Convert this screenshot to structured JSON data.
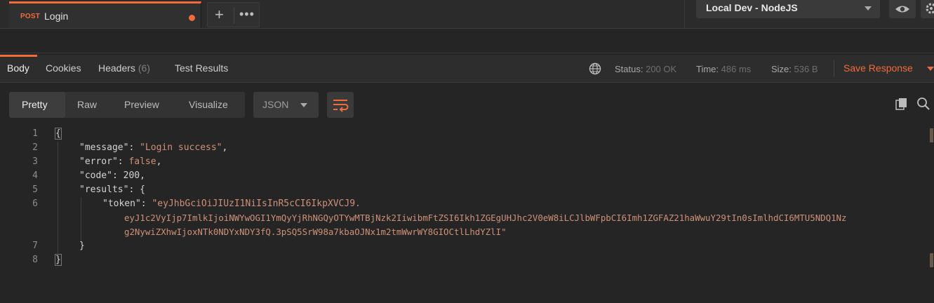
{
  "tab": {
    "method": "POST",
    "name": "Login"
  },
  "environment": {
    "selected": "Local Dev - NodeJS"
  },
  "response_tabs": {
    "body": "Body",
    "cookies": "Cookies",
    "headers": "Headers",
    "headers_count": "(6)",
    "test_results": "Test Results"
  },
  "status": {
    "status_label": "Status:",
    "status_value": "200 OK",
    "time_label": "Time:",
    "time_value": "486 ms",
    "size_label": "Size:",
    "size_value": "536 B",
    "save_response": "Save Response"
  },
  "view_modes": {
    "pretty": "Pretty",
    "raw": "Raw",
    "preview": "Preview",
    "visualize": "Visualize",
    "format": "JSON"
  },
  "code": {
    "line_numbers": [
      "1",
      "2",
      "3",
      "4",
      "5",
      "6",
      "7",
      "8"
    ],
    "open_brace": "{",
    "message_key": "\"message\"",
    "message_value": "\"Login success\"",
    "error_key": "\"error\"",
    "error_value": "false",
    "code_key": "\"code\"",
    "code_value": "200",
    "results_key": "\"results\"",
    "token_key": "\"token\"",
    "token_value_1": "\"eyJhbGciOiJIUzI1NiIsInR5cCI6IkpXVCJ9.",
    "token_value_2": "eyJ1c2VyIjp7ImlkIjoiNWYwOGI1YmQyYjRhNGQyOTYwMTBjNzk2IiwibmFtZSI6Ikh1ZGEgUHJhc2V0eW8iLCJlbWFpbCI6Imh1ZGFAZ21haWwuY29tIn0sImlhdCI6MTU5NDQ1Nz",
    "token_value_3": "g2NywiZXhwIjoxNTk0NDYxNDY3fQ.3pSQ5SrW98a7kbaOJNx1m2tmWwrWY8GIOCtlLhdYZlI\"",
    "close_inner": "}",
    "close_brace": "}"
  },
  "colors": {
    "accent": "#f26b3a",
    "string": "#ce9178",
    "background": "#252525"
  }
}
